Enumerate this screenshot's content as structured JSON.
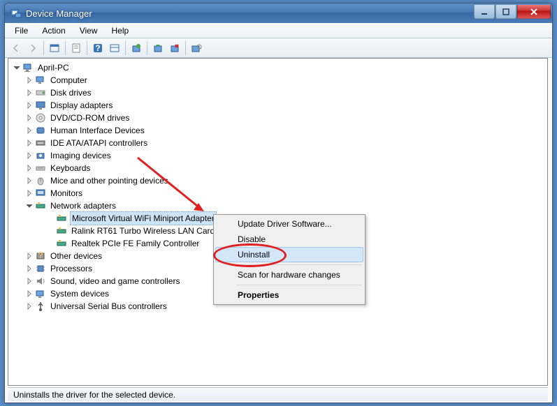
{
  "window": {
    "title": "Device Manager"
  },
  "menubar": {
    "items": [
      "File",
      "Action",
      "View",
      "Help"
    ]
  },
  "tree": {
    "root": "April-PC",
    "categories": [
      {
        "label": "Computer",
        "icon": "computer",
        "expanded": false
      },
      {
        "label": "Disk drives",
        "icon": "disk",
        "expanded": false
      },
      {
        "label": "Display adapters",
        "icon": "display",
        "expanded": false
      },
      {
        "label": "DVD/CD-ROM drives",
        "icon": "dvd",
        "expanded": false
      },
      {
        "label": "Human Interface Devices",
        "icon": "hid",
        "expanded": false
      },
      {
        "label": "IDE ATA/ATAPI controllers",
        "icon": "ide",
        "expanded": false
      },
      {
        "label": "Imaging devices",
        "icon": "imaging",
        "expanded": false
      },
      {
        "label": "Keyboards",
        "icon": "keyboard",
        "expanded": false
      },
      {
        "label": "Mice and other pointing devices",
        "icon": "mouse",
        "expanded": false
      },
      {
        "label": "Monitors",
        "icon": "monitor",
        "expanded": false
      },
      {
        "label": "Network adapters",
        "icon": "network",
        "expanded": true,
        "children": [
          {
            "label": "Microsoft Virtual WiFi Miniport Adapter",
            "selected": true
          },
          {
            "label": "Ralink RT61 Turbo Wireless LAN Card"
          },
          {
            "label": "Realtek PCIe FE Family Controller"
          }
        ]
      },
      {
        "label": "Other devices",
        "icon": "other",
        "expanded": false
      },
      {
        "label": "Processors",
        "icon": "processor",
        "expanded": false
      },
      {
        "label": "Sound, video and game controllers",
        "icon": "sound",
        "expanded": false
      },
      {
        "label": "System devices",
        "icon": "system",
        "expanded": false
      },
      {
        "label": "Universal Serial Bus controllers",
        "icon": "usb",
        "expanded": false
      }
    ]
  },
  "context_menu": {
    "items": [
      {
        "label": "Update Driver Software...",
        "sep_after": false
      },
      {
        "label": "Disable",
        "sep_after": false
      },
      {
        "label": "Uninstall",
        "sep_after": true,
        "highlighted": true
      },
      {
        "label": "Scan for hardware changes",
        "sep_after": true
      },
      {
        "label": "Properties",
        "bold": true
      }
    ]
  },
  "statusbar": {
    "text": "Uninstalls the driver for the selected device."
  }
}
